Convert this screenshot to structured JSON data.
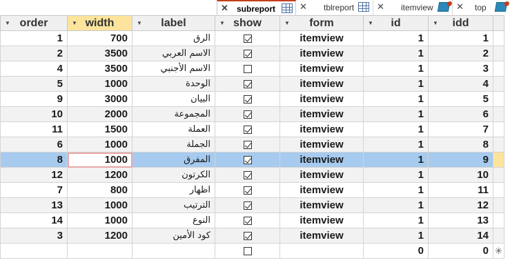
{
  "tabs": [
    {
      "label": "subreport",
      "icon": "table-icon",
      "active": true
    },
    {
      "label": "tblreport",
      "icon": "table-icon",
      "active": false
    },
    {
      "label": "itemview",
      "icon": "form-icon",
      "active": false
    },
    {
      "label": "top",
      "icon": "form-icon",
      "active": false
    }
  ],
  "grid": {
    "columns": [
      "order",
      "width",
      "label",
      "show",
      "form",
      "id",
      "idd"
    ],
    "highlighted_column": "width",
    "current_row_index": 8,
    "rows": [
      {
        "order": "1",
        "width": "700",
        "label": "الرق",
        "show": true,
        "form": "itemview",
        "id": "1",
        "idd": "1"
      },
      {
        "order": "2",
        "width": "3500",
        "label": "الاسم العربي",
        "show": true,
        "form": "itemview",
        "id": "1",
        "idd": "2"
      },
      {
        "order": "4",
        "width": "3500",
        "label": "الاسم الأجنبي",
        "show": false,
        "form": "itemview",
        "id": "1",
        "idd": "3"
      },
      {
        "order": "5",
        "width": "1000",
        "label": "الوحدة",
        "show": true,
        "form": "itemview",
        "id": "1",
        "idd": "4"
      },
      {
        "order": "9",
        "width": "3000",
        "label": "البيان",
        "show": true,
        "form": "itemview",
        "id": "1",
        "idd": "5"
      },
      {
        "order": "10",
        "width": "2000",
        "label": "المجموعة",
        "show": true,
        "form": "itemview",
        "id": "1",
        "idd": "6"
      },
      {
        "order": "11",
        "width": "1500",
        "label": "العملة",
        "show": true,
        "form": "itemview",
        "id": "1",
        "idd": "7"
      },
      {
        "order": "6",
        "width": "1000",
        "label": "الجملة",
        "show": true,
        "form": "itemview",
        "id": "1",
        "idd": "8"
      },
      {
        "order": "8",
        "width": "1000",
        "label": "المفرق",
        "show": true,
        "form": "itemview",
        "id": "1",
        "idd": "9"
      },
      {
        "order": "12",
        "width": "1200",
        "label": "الكرتون",
        "show": true,
        "form": "itemview",
        "id": "1",
        "idd": "10"
      },
      {
        "order": "7",
        "width": "800",
        "label": "اظهار",
        "show": true,
        "form": "itemview",
        "id": "1",
        "idd": "11"
      },
      {
        "order": "13",
        "width": "1000",
        "label": "الترتيب",
        "show": true,
        "form": "itemview",
        "id": "1",
        "idd": "12"
      },
      {
        "order": "14",
        "width": "1000",
        "label": "النوع",
        "show": true,
        "form": "itemview",
        "id": "1",
        "idd": "13"
      },
      {
        "order": "3",
        "width": "1200",
        "label": "كود الأمين",
        "show": true,
        "form": "itemview",
        "id": "1",
        "idd": "14"
      }
    ],
    "new_row": {
      "show": false,
      "id": "0",
      "idd": "0",
      "marker": "✳"
    }
  }
}
